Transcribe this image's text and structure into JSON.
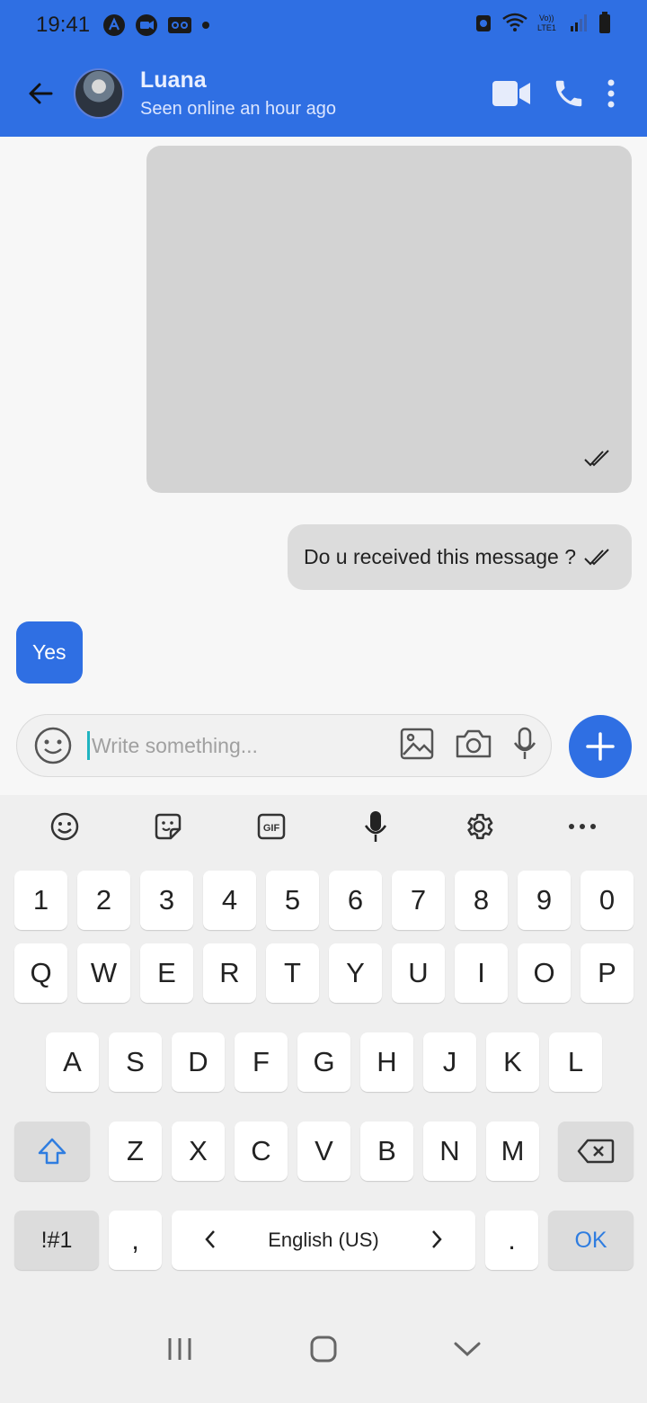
{
  "status_bar": {
    "time": "19:41"
  },
  "header": {
    "contact_name": "Luana",
    "contact_status": "Seen online an hour ago"
  },
  "messages": [
    {
      "type": "image",
      "direction": "outgoing",
      "read": true
    },
    {
      "type": "text",
      "direction": "outgoing",
      "text": "Do u received this message ?",
      "read": true
    },
    {
      "type": "text",
      "direction": "incoming",
      "text": "Yes"
    }
  ],
  "composer": {
    "placeholder": "Write something..."
  },
  "keyboard": {
    "toolbar": [
      "emoji-icon",
      "sticker-icon",
      "gif-icon",
      "mic-icon",
      "settings-icon",
      "more-icon"
    ],
    "gif_label": "GIF",
    "row_numbers": [
      "1",
      "2",
      "3",
      "4",
      "5",
      "6",
      "7",
      "8",
      "9",
      "0"
    ],
    "row_q": [
      "Q",
      "W",
      "E",
      "R",
      "T",
      "Y",
      "U",
      "I",
      "O",
      "P"
    ],
    "row_a": [
      "A",
      "S",
      "D",
      "F",
      "G",
      "H",
      "J",
      "K",
      "L"
    ],
    "row_z": [
      "Z",
      "X",
      "C",
      "V",
      "B",
      "N",
      "M"
    ],
    "symbols_label": "!#1",
    "comma": ",",
    "space_label": "English (US)",
    "period": ".",
    "ok_label": "OK"
  },
  "colors": {
    "accent": "#2f6fe3",
    "bubble_out": "#dcdcdc",
    "image_placeholder": "#d3d3d3"
  }
}
